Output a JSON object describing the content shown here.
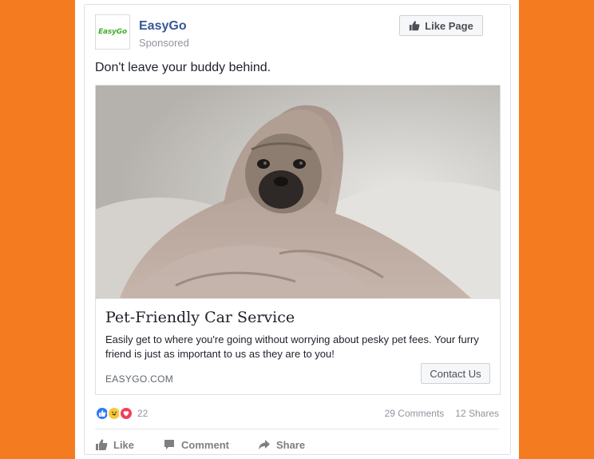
{
  "page": {
    "name": "EasyGo",
    "logo_text": "EasyGo",
    "sponsored": "Sponsored",
    "like_page_label": "Like Page"
  },
  "post": {
    "text": "Don't leave your buddy behind."
  },
  "link": {
    "title": "Pet-Friendly Car Service",
    "description": "Easily get to where you're going without worrying about pesky pet fees. Your furry friend is just as important to us as they are to you!",
    "domain": "EASYGO.COM",
    "cta_label": "Contact Us"
  },
  "reactions": {
    "types": [
      "like",
      "haha",
      "love"
    ],
    "count": "22",
    "comments": "29 Comments",
    "shares": "12 Shares"
  },
  "actions": {
    "like": "Like",
    "comment": "Comment",
    "share": "Share"
  },
  "colors": {
    "background": "#F47B20",
    "brand_name": "#365899",
    "logo_green": "#43b02a"
  }
}
